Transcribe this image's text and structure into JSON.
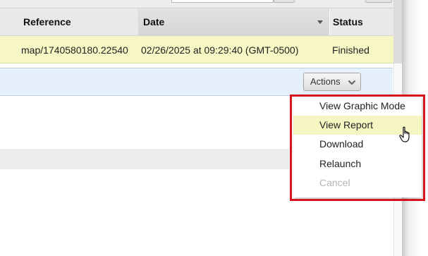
{
  "table": {
    "columns": [
      "Reference",
      "Date",
      "Status"
    ],
    "sort_column": "Date",
    "rows": [
      {
        "reference": "map/1740580180.22540",
        "date": "02/26/2025 at 09:29:40 (GMT-0500)",
        "status": "Finished"
      }
    ]
  },
  "detail": {
    "actions_label": "Actions"
  },
  "menu": {
    "items": [
      {
        "label": "View Graphic Mode",
        "enabled": true
      },
      {
        "label": "View Report",
        "enabled": true,
        "hovered": true
      },
      {
        "label": "Download",
        "enabled": true
      },
      {
        "label": "Relaunch",
        "enabled": true
      },
      {
        "label": "Cancel",
        "enabled": false
      }
    ]
  },
  "colors": {
    "selected_row": "#f6f7c4",
    "highlight_outline": "#d5141c",
    "detail_bar": "#e6f0fa"
  },
  "icons": [
    "chevron-down-icon",
    "sort-desc-icon",
    "hand-pointer-icon"
  ]
}
